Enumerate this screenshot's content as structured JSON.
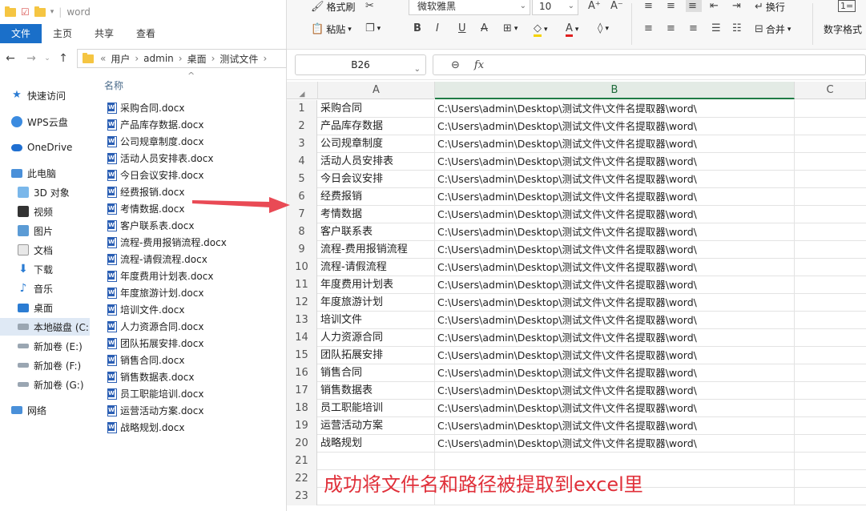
{
  "explorer": {
    "window_title": "word",
    "ribbon_tabs": [
      "文件",
      "主页",
      "共享",
      "查看"
    ],
    "address_parts": [
      "«",
      "用户",
      "›",
      "admin",
      "›",
      "桌面",
      "›",
      "测试文件",
      "›"
    ],
    "nav_items": [
      "快速访问",
      "WPS云盘",
      "OneDrive",
      "此电脑",
      "3D 对象",
      "视频",
      "图片",
      "文档",
      "下载",
      "音乐",
      "桌面",
      "本地磁盘 (C:",
      "新加卷 (E:)",
      "新加卷 (F:)",
      "新加卷 (G:)",
      "网络"
    ],
    "column_header": "名称",
    "files": [
      "采购合同.docx",
      "产品库存数据.docx",
      "公司规章制度.docx",
      "活动人员安排表.docx",
      "今日会议安排.docx",
      "经费报销.docx",
      "考情数据.docx",
      "客户联系表.docx",
      "流程-费用报销流程.docx",
      "流程-请假流程.docx",
      "年度费用计划表.docx",
      "年度旅游计划.docx",
      "培训文件.docx",
      "人力资源合同.docx",
      "团队拓展安排.docx",
      "销售合同.docx",
      "销售数据表.docx",
      "员工职能培训.docx",
      "运营活动方案.docx",
      "战略规划.docx"
    ]
  },
  "excel": {
    "ribbon": {
      "format_painter": "格式刷",
      "paste": "粘贴",
      "font_name": "微软雅黑",
      "font_size": "10",
      "wrap": "换行",
      "merge": "合并",
      "number_format": "数字格式"
    },
    "name_box": "B26",
    "fx_label": "fx",
    "columns": [
      "A",
      "B",
      "C"
    ],
    "rows": [
      {
        "n": "1",
        "a": "采购合同",
        "b": "C:\\Users\\admin\\Desktop\\测试文件\\文件名提取器\\word\\"
      },
      {
        "n": "2",
        "a": "产品库存数据",
        "b": "C:\\Users\\admin\\Desktop\\测试文件\\文件名提取器\\word\\"
      },
      {
        "n": "3",
        "a": "公司规章制度",
        "b": "C:\\Users\\admin\\Desktop\\测试文件\\文件名提取器\\word\\"
      },
      {
        "n": "4",
        "a": "活动人员安排表",
        "b": "C:\\Users\\admin\\Desktop\\测试文件\\文件名提取器\\word\\"
      },
      {
        "n": "5",
        "a": "今日会议安排",
        "b": "C:\\Users\\admin\\Desktop\\测试文件\\文件名提取器\\word\\"
      },
      {
        "n": "6",
        "a": "经费报销",
        "b": "C:\\Users\\admin\\Desktop\\测试文件\\文件名提取器\\word\\"
      },
      {
        "n": "7",
        "a": "考情数据",
        "b": "C:\\Users\\admin\\Desktop\\测试文件\\文件名提取器\\word\\"
      },
      {
        "n": "8",
        "a": "客户联系表",
        "b": "C:\\Users\\admin\\Desktop\\测试文件\\文件名提取器\\word\\"
      },
      {
        "n": "9",
        "a": "流程-费用报销流程",
        "b": "C:\\Users\\admin\\Desktop\\测试文件\\文件名提取器\\word\\"
      },
      {
        "n": "10",
        "a": "流程-请假流程",
        "b": "C:\\Users\\admin\\Desktop\\测试文件\\文件名提取器\\word\\"
      },
      {
        "n": "11",
        "a": "年度费用计划表",
        "b": "C:\\Users\\admin\\Desktop\\测试文件\\文件名提取器\\word\\"
      },
      {
        "n": "12",
        "a": "年度旅游计划",
        "b": "C:\\Users\\admin\\Desktop\\测试文件\\文件名提取器\\word\\"
      },
      {
        "n": "13",
        "a": "培训文件",
        "b": "C:\\Users\\admin\\Desktop\\测试文件\\文件名提取器\\word\\"
      },
      {
        "n": "14",
        "a": "人力资源合同",
        "b": "C:\\Users\\admin\\Desktop\\测试文件\\文件名提取器\\word\\"
      },
      {
        "n": "15",
        "a": "团队拓展安排",
        "b": "C:\\Users\\admin\\Desktop\\测试文件\\文件名提取器\\word\\"
      },
      {
        "n": "16",
        "a": "销售合同",
        "b": "C:\\Users\\admin\\Desktop\\测试文件\\文件名提取器\\word\\"
      },
      {
        "n": "17",
        "a": "销售数据表",
        "b": "C:\\Users\\admin\\Desktop\\测试文件\\文件名提取器\\word\\"
      },
      {
        "n": "18",
        "a": "员工职能培训",
        "b": "C:\\Users\\admin\\Desktop\\测试文件\\文件名提取器\\word\\"
      },
      {
        "n": "19",
        "a": "运营活动方案",
        "b": "C:\\Users\\admin\\Desktop\\测试文件\\文件名提取器\\word\\"
      },
      {
        "n": "20",
        "a": "战略规划",
        "b": "C:\\Users\\admin\\Desktop\\测试文件\\文件名提取器\\word\\"
      },
      {
        "n": "21",
        "a": "",
        "b": ""
      },
      {
        "n": "22",
        "a": "",
        "b": ""
      },
      {
        "n": "23",
        "a": "",
        "b": ""
      }
    ]
  },
  "annotation": {
    "text": "成功将文件名和路径被提取到excel里",
    "color": "#e0303a"
  },
  "colors": {
    "explorer_accent": "#1a6fc9",
    "excel_accent": "#1e7b45",
    "word_icon": "#2b5fb4"
  }
}
